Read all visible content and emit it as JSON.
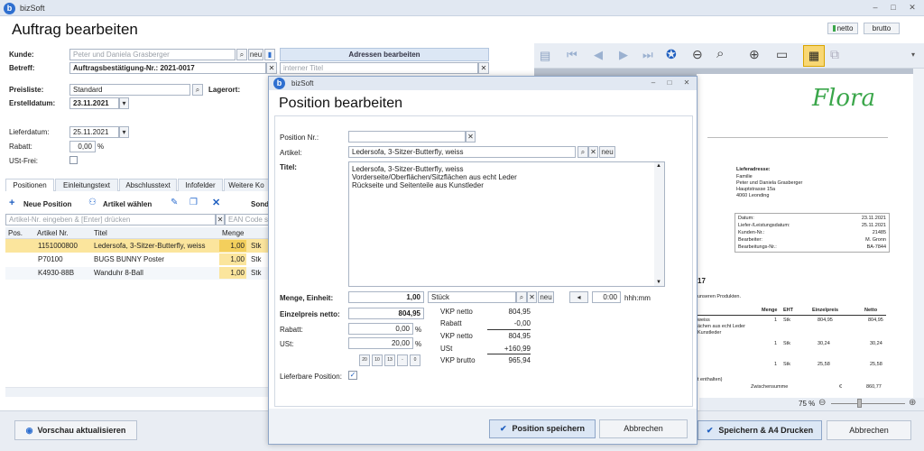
{
  "app": {
    "title": "bizSoft",
    "logo": "b"
  },
  "window": {
    "minimize": "–",
    "maximize": "□",
    "close": "✕"
  },
  "header": {
    "title": "Auftrag bearbeiten",
    "netto": "netto",
    "brutto": "brutto"
  },
  "form": {
    "kunde_label": "Kunde:",
    "kunde_value": "Peter und Daniela Grasberger",
    "neu": "neu",
    "betreff_label": "Betreff:",
    "betreff_value": "Auftragsbestätigung-Nr.: 2021-0017",
    "adressen_button": "Adressen bearbeiten",
    "interner_titel_placeholder": "interner Titel",
    "preisliste_label": "Preisliste:",
    "preisliste_value": "Standard",
    "lagerort_label": "Lagerort:",
    "erstelldatum_label": "Erstelldatum:",
    "erstelldatum_value": "23.11.2021",
    "lieferdatum_label": "Lieferdatum:",
    "lieferdatum_value": "25.11.2021",
    "rabatt_label": "Rabatt:",
    "rabatt_value": "0,00",
    "percent": "%",
    "ust_frei_label": "USt-Frei:"
  },
  "tabs": [
    "Positionen",
    "Einleitungstext",
    "Abschlusstext",
    "Infofelder",
    "Weitere Ko"
  ],
  "toolbar": {
    "neue_position": "Neue Position",
    "artikel_waehlen": "Artikel wählen",
    "sonst": "Sond"
  },
  "article_input_placeholder": "Artikel-Nr. eingeben & [Enter] drücken",
  "ean_placeholder": "EAN Code sc",
  "grid": {
    "headers": [
      "Pos.",
      "Artikel Nr.",
      "Titel",
      "Menge",
      ""
    ],
    "rows": [
      [
        "",
        "1151000800",
        "Ledersofa, 3-Sitzer-Butterfly, weiss",
        "1,00",
        "Stk"
      ],
      [
        "",
        "P70100",
        "BUGS BUNNY Poster",
        "1,00",
        "Stk"
      ],
      [
        "",
        "K4930-88B",
        "Wanduhr 8-Ball",
        "1,00",
        "Stk"
      ]
    ]
  },
  "bottom": {
    "vorschau": "Vorschau aktualisieren",
    "speichern": "Speichern & A4 Drucken",
    "abbrechen": "Abbrechen",
    "zoom": "75 %"
  },
  "dialog": {
    "app_title": "bizSoft",
    "title": "Position bearbeiten",
    "position_nr_label": "Position Nr.:",
    "artikel_label": "Artikel:",
    "artikel_value": "Ledersofa, 3-Sitzer-Butterfly, weiss",
    "neu": "neu",
    "titel_label": "Titel:",
    "titel_lines": [
      "Ledersofa, 3-Sitzer-Butterfly, weiss",
      "Vorderseite/Oberflächen/Sitzflächen aus echt Leder",
      "Rückseite und Seitenteile aus Kunstleder"
    ],
    "menge_label": "Menge, Einheit:",
    "menge_value": "1,00",
    "einheit_value": "Stück",
    "time_value": "0:00",
    "time_unit": "hhh:mm",
    "einzelpreis_label": "Einzelpreis netto:",
    "einzelpreis_value": "804,95",
    "rabatt_label": "Rabatt:",
    "rabatt_value": "0,00",
    "ust_label": "USt:",
    "ust_value": "20,00",
    "percent": "%",
    "ust_presets": [
      "20",
      "10",
      "13",
      "-",
      "0"
    ],
    "calc": [
      [
        "VKP netto",
        "804,95"
      ],
      [
        "Rabatt",
        "-0,00"
      ],
      [
        "VKP netto",
        "804,95"
      ],
      [
        "USt",
        "+160,99"
      ],
      [
        "VKP brutto",
        "965,94"
      ]
    ],
    "lieferbare_label": "Lieferbare Position:",
    "save": "Position speichern",
    "cancel": "Abbrechen"
  },
  "doc": {
    "brand": "Flora",
    "lieferadresse_label": "Lieferadresse:",
    "address": [
      "Familie",
      "Peter und Daniela Grasberger",
      "Hauptstrasse 15a",
      "4060 Leonding"
    ],
    "info": [
      [
        "Datum:",
        "23.11.2021"
      ],
      [
        "Liefer-/Leistungsdatum:",
        "25.11.2021"
      ],
      [
        "Kunden-Nr.:",
        "21485"
      ],
      [
        "Bearbeiter:",
        "M. Gronn"
      ],
      [
        "Bearbeitungs-Nr.:",
        "BA-7844"
      ]
    ],
    "heading": "17",
    "intro": "unseren Produkten.",
    "cols": [
      "Menge",
      "EHT",
      "Einzelpreis",
      "Netto"
    ],
    "lines": [
      [
        "weiss",
        "1",
        "Stk",
        "804,95",
        "804,95"
      ],
      [
        "ächen aus echt Leder",
        "",
        "",
        "",
        ""
      ],
      [
        "Kunstleder",
        "",
        "",
        "",
        ""
      ],
      [
        "",
        "1",
        "Stk",
        "30,24",
        "30,24"
      ],
      [
        "",
        "1",
        "Stk",
        "25,58",
        "25,58"
      ],
      [
        "t enthalten)",
        "",
        "",
        "",
        ""
      ]
    ],
    "zwischensumme_label": "Zwischensumme",
    "zwischensumme_cur": "€",
    "zwischensumme_value": "860,77"
  }
}
